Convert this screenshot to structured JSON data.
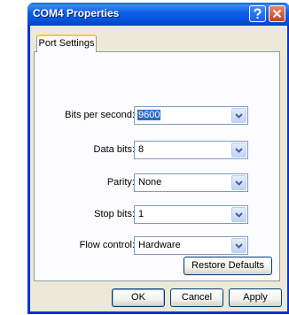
{
  "window": {
    "title": "COM4 Properties"
  },
  "tabs": [
    {
      "label": "Port Settings",
      "active": true
    }
  ],
  "settings": [
    {
      "label": "Bits per second:",
      "value": "9600",
      "selected": true
    },
    {
      "label": "Data bits:",
      "value": "8"
    },
    {
      "label": "Parity:",
      "value": "None"
    },
    {
      "label": "Stop bits:",
      "value": "1"
    },
    {
      "label": "Flow control:",
      "value": "Hardware"
    }
  ],
  "buttons": {
    "restore_defaults": "Restore Defaults",
    "ok": "OK",
    "cancel": "Cancel",
    "apply": "Apply"
  },
  "icons": {
    "help": "question-mark-icon",
    "close": "close-x-icon",
    "dropdown": "chevron-down-icon"
  },
  "colors": {
    "titlebar": "#0a5fe8",
    "selection": "#316ac5",
    "dialog_bg": "#ece9d8"
  }
}
